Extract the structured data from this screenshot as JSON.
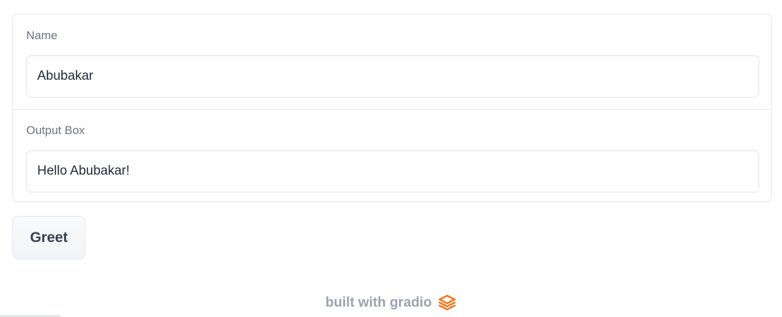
{
  "form": {
    "name_field": {
      "label": "Name",
      "value": "Abubakar"
    },
    "output_field": {
      "label": "Output Box",
      "value": "Hello Abubakar!"
    }
  },
  "actions": {
    "greet_label": "Greet"
  },
  "footer": {
    "text": "built with gradio",
    "logo_icon": "gradio-logo-icon",
    "logo_color": "#f97316"
  }
}
